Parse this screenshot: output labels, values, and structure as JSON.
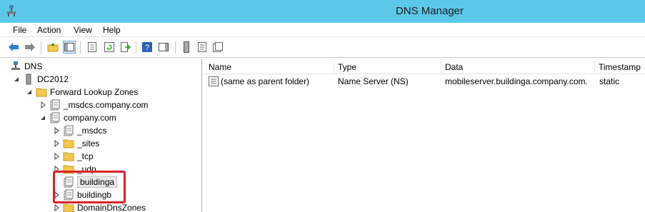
{
  "window": {
    "title": "DNS Manager"
  },
  "menu": [
    {
      "label": "File"
    },
    {
      "label": "Action"
    },
    {
      "label": "View"
    },
    {
      "label": "Help"
    }
  ],
  "tree": {
    "root": "DNS",
    "server": "DC2012",
    "forward_zones": "Forward Lookup Zones",
    "msdcs_zone": "_msdcs.company.com",
    "company_zone": "company.com",
    "children": [
      "_msdcs",
      "_sites",
      "_tcp",
      "_udp",
      "buildinga",
      "buildingb",
      "DomainDnsZones"
    ]
  },
  "list": {
    "columns": [
      "Name",
      "Type",
      "Data",
      "Timestamp"
    ],
    "rows": [
      {
        "name": "(same as parent folder)",
        "type": "Name Server (NS)",
        "data": "mobileserver.buildinga.company.com.",
        "timestamp": "static"
      }
    ]
  },
  "colors": {
    "titlebar": "#5bc8ea",
    "highlight": "#d9232b",
    "folder": "#f2c94c"
  }
}
